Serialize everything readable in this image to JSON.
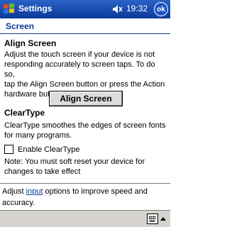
{
  "titlebar": {
    "title": "Settings",
    "time": "19:32",
    "ok_label": "ok"
  },
  "page": {
    "header": "Screen"
  },
  "align_section": {
    "title": "Align Screen",
    "description_lines": [
      "Adjust the touch screen if your device is not",
      "responding accurately to screen taps. To do so,",
      "tap the Align Screen button or press the Action",
      "hardware button."
    ],
    "button_label": "Align Screen"
  },
  "cleartype_section": {
    "title": "ClearType",
    "description_lines": [
      "ClearType smoothes the edges of screen fonts",
      "for many programs."
    ],
    "checkbox_label": "Enable ClearType",
    "checkbox_checked": false,
    "note_lines": [
      "Note: You must soft reset your device for",
      "changes to take effect"
    ]
  },
  "footer": {
    "prefix": "Adjust ",
    "link": "input",
    "suffix": " options to improve speed and",
    "line2": "accuracy."
  },
  "icons": {
    "start": "windows-flag-icon",
    "volume": "speaker-icon",
    "sip": "keyboard-icon"
  },
  "colors": {
    "titlebar": "#0b3a98",
    "accent": "#0b3a98"
  }
}
